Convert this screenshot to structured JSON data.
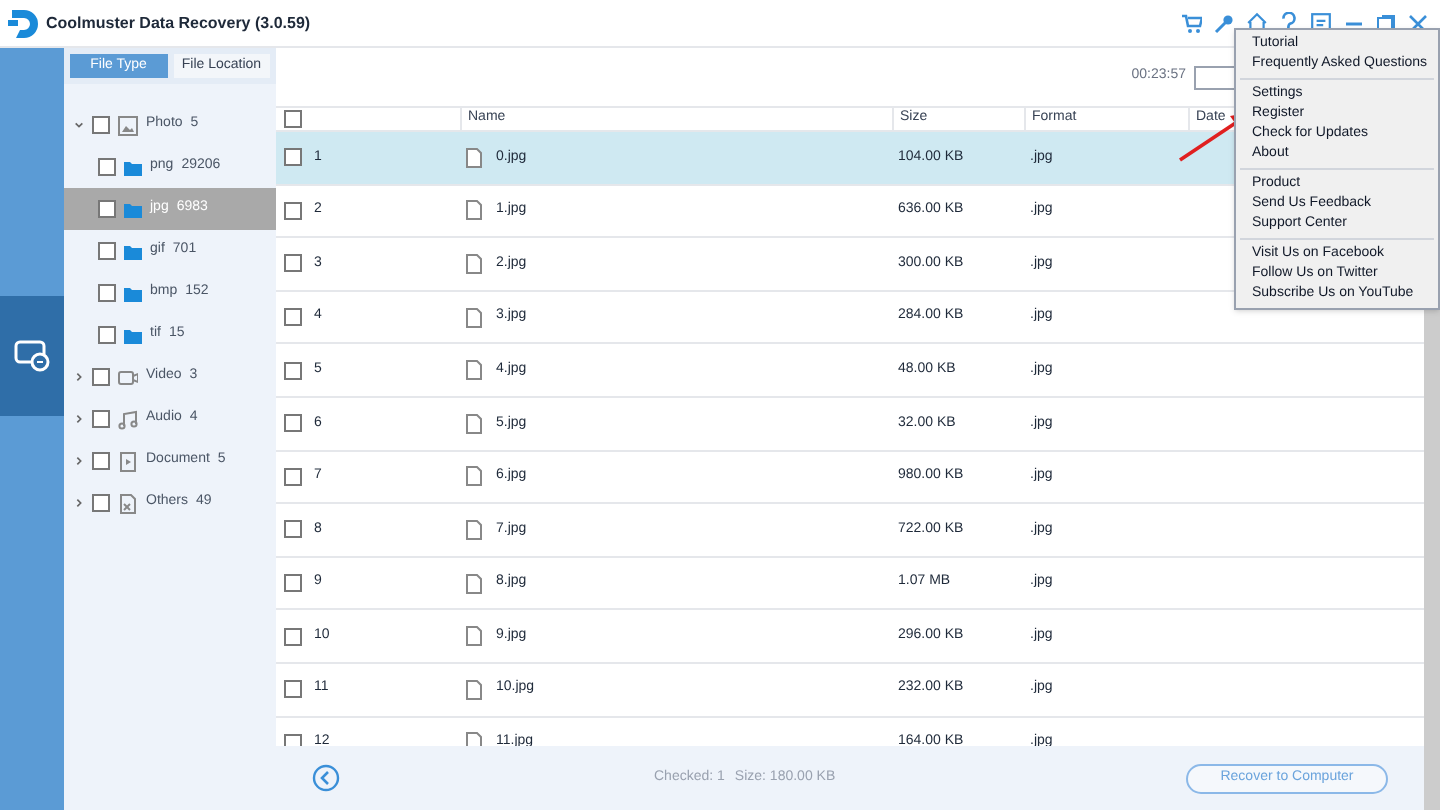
{
  "window": {
    "title": "Coolmuster Data Recovery (3.0.59)"
  },
  "view_tabs": [
    {
      "label": "File Type",
      "selected": true
    },
    {
      "label": "File Location",
      "selected": false
    }
  ],
  "tree": [
    {
      "label": "Photo",
      "count": "5",
      "kind": "photo",
      "expanded": true,
      "checked": false,
      "selected": false,
      "children": [
        {
          "label": "png",
          "count": "29206",
          "checked": false,
          "selected": false
        },
        {
          "label": "jpg",
          "count": "6983",
          "checked": false,
          "selected": true
        },
        {
          "label": "gif",
          "count": "701",
          "checked": false,
          "selected": false
        },
        {
          "label": "bmp",
          "count": "152",
          "checked": false,
          "selected": false
        },
        {
          "label": "tif",
          "count": "15",
          "checked": false,
          "selected": false
        }
      ]
    },
    {
      "label": "Video",
      "count": "3",
      "kind": "video",
      "expanded": false,
      "checked": false,
      "selected": false
    },
    {
      "label": "Audio",
      "count": "4",
      "kind": "audio",
      "expanded": false,
      "checked": false,
      "selected": false
    },
    {
      "label": "Document",
      "count": "5",
      "kind": "document",
      "expanded": false,
      "checked": false,
      "selected": false
    },
    {
      "label": "Others",
      "count": "49",
      "kind": "others",
      "expanded": false,
      "checked": false,
      "selected": false
    }
  ],
  "elapsed": "00:23:57",
  "table": {
    "all_checked": false,
    "columns": [
      "Name",
      "Size",
      "Format",
      "Date"
    ],
    "rows": [
      {
        "index": "1",
        "name": "0.jpg",
        "size": "104.00 KB",
        "format": ".jpg",
        "checked": false,
        "selected": true
      },
      {
        "index": "2",
        "name": "1.jpg",
        "size": "636.00 KB",
        "format": ".jpg",
        "checked": false,
        "selected": false
      },
      {
        "index": "3",
        "name": "2.jpg",
        "size": "300.00 KB",
        "format": ".jpg",
        "checked": false,
        "selected": false
      },
      {
        "index": "4",
        "name": "3.jpg",
        "size": "284.00 KB",
        "format": ".jpg",
        "checked": false,
        "selected": false
      },
      {
        "index": "5",
        "name": "4.jpg",
        "size": "48.00 KB",
        "format": ".jpg",
        "checked": false,
        "selected": false
      },
      {
        "index": "6",
        "name": "5.jpg",
        "size": "32.00 KB",
        "format": ".jpg",
        "checked": false,
        "selected": false
      },
      {
        "index": "7",
        "name": "6.jpg",
        "size": "980.00 KB",
        "format": ".jpg",
        "checked": false,
        "selected": false
      },
      {
        "index": "8",
        "name": "7.jpg",
        "size": "722.00 KB",
        "format": ".jpg",
        "checked": false,
        "selected": false
      },
      {
        "index": "9",
        "name": "8.jpg",
        "size": "1.07 MB",
        "format": ".jpg",
        "checked": false,
        "selected": false
      },
      {
        "index": "10",
        "name": "9.jpg",
        "size": "296.00 KB",
        "format": ".jpg",
        "checked": false,
        "selected": false
      },
      {
        "index": "11",
        "name": "10.jpg",
        "size": "232.00 KB",
        "format": ".jpg",
        "checked": false,
        "selected": false
      },
      {
        "index": "12",
        "name": "11.jpg",
        "size": "164.00 KB",
        "format": ".jpg",
        "checked": false,
        "selected": false
      }
    ]
  },
  "status": {
    "checked": "Checked: 1",
    "size": "Size: 180.00 KB"
  },
  "recover_button": "Recover to Computer",
  "menu": [
    [
      "Tutorial",
      "Frequently Asked Questions"
    ],
    [
      "Settings",
      "Register",
      "Check for Updates",
      "About"
    ],
    [
      "Product",
      "Send Us Feedback",
      "Support Center"
    ],
    [
      "Visit Us on Facebook",
      "Follow Us on Twitter",
      "Subscribe Us on YouTube"
    ]
  ]
}
